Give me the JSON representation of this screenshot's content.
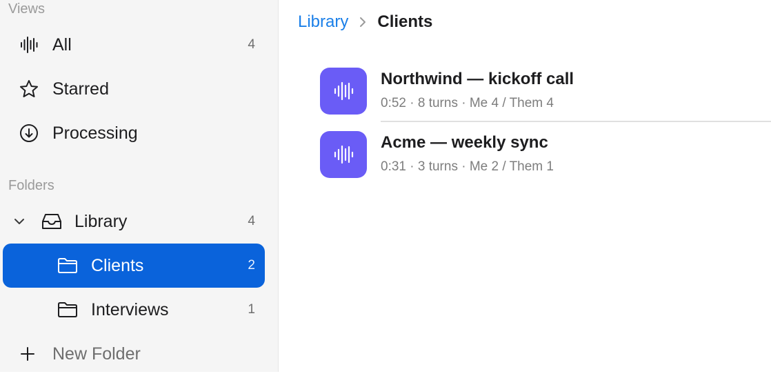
{
  "sidebar": {
    "views_label": "Views",
    "views": [
      {
        "label": "All",
        "count": "4",
        "icon": "waveform-icon"
      },
      {
        "label": "Starred",
        "count": "",
        "icon": "star-icon"
      },
      {
        "label": "Processing",
        "count": "",
        "icon": "download-circle-icon"
      }
    ],
    "folders_label": "Folders",
    "library": {
      "label": "Library",
      "count": "4"
    },
    "folders": [
      {
        "label": "Clients",
        "count": "2",
        "selected": true
      },
      {
        "label": "Interviews",
        "count": "1",
        "selected": false
      }
    ],
    "new_folder_label": "New Folder"
  },
  "breadcrumb": {
    "parent": "Library",
    "current": "Clients"
  },
  "recordings": [
    {
      "title": "Northwind — kickoff call",
      "meta": "0:52 · 8 turns · Me 4 / Them 4"
    },
    {
      "title": "Acme — weekly sync",
      "meta": "0:31 · 3 turns · Me 2 / Them 1"
    }
  ],
  "colors": {
    "accent": "#0a63db",
    "tile": "#6a5cf6",
    "link": "#1a7fe8"
  }
}
